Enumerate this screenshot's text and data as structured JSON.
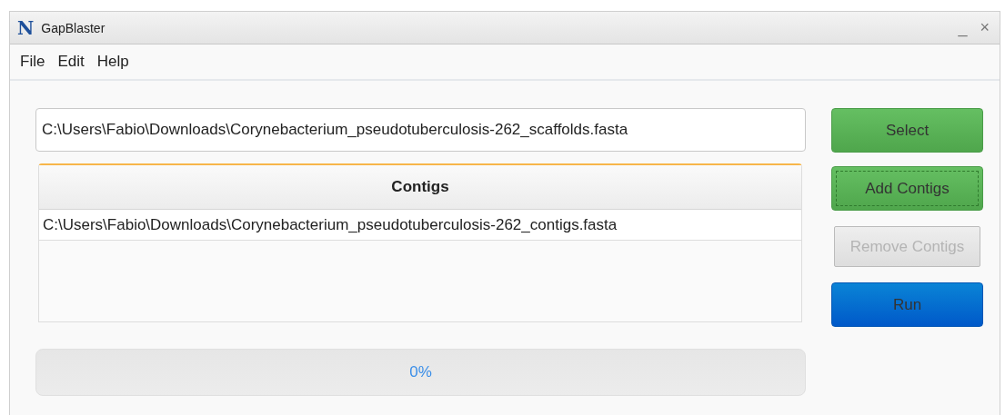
{
  "window": {
    "title": "GapBlaster",
    "logo": "N",
    "controls": [
      "_",
      "×"
    ]
  },
  "menu": [
    "File",
    "Edit",
    "Help"
  ],
  "file_field": {
    "value": "C:\\Users\\Fabio\\Downloads\\Corynebacterium_pseudotuberculosis-262_scaffolds.fasta"
  },
  "table": {
    "columns": [
      "Contigs"
    ],
    "rows": [
      {
        "cells": [
          "C:\\Users\\Fabio\\Downloads\\Corynebacterium_pseudotuberculosis-262_contigs.fasta"
        ],
        "selected": false
      }
    ]
  },
  "buttons": [
    {
      "label": "Select",
      "kind": "green",
      "disabled": false,
      "focused": false
    },
    {
      "label": "Add Contigs",
      "kind": "green",
      "disabled": false,
      "focused": true
    },
    {
      "label": "Remove Contigs",
      "kind": "plain",
      "disabled": true,
      "focused": false
    },
    {
      "label": "Run",
      "kind": "blue",
      "disabled": false,
      "focused": false
    }
  ],
  "progress": {
    "level": 0,
    "reading": "0%"
  }
}
